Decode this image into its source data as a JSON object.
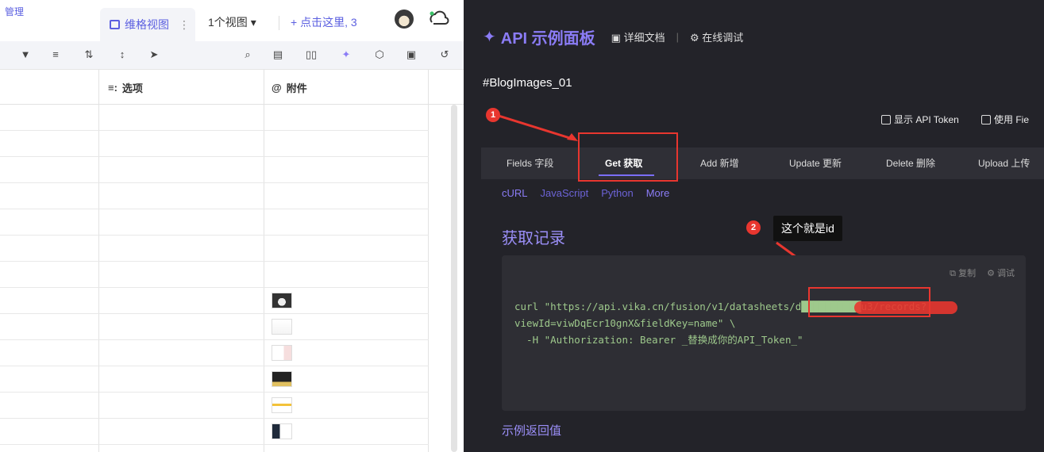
{
  "left_panel": {
    "manage": "管理",
    "view_tab": "维格视图",
    "view_tab_more": "⋮",
    "view_count": "1个视图",
    "add_view": "点击这里, 3",
    "columns": [
      {
        "label": "选项",
        "icon": "≡:"
      },
      {
        "label": "附件",
        "icon": "@"
      }
    ],
    "toolbar_icons": [
      "filter-icon",
      "group-icon",
      "sort-icon",
      "row-height-icon",
      "share-icon",
      "search-icon",
      "form-icon",
      "gallery-icon",
      "api-icon",
      "robot-icon",
      "widget-icon",
      "history-icon"
    ],
    "thumbnail_count": 6
  },
  "right_panel": {
    "title": "API 示例面板",
    "doc_link": "详细文档",
    "debug_link": "在线调试",
    "datasheet_name": "#BlogImages_01",
    "checkbox_token": "显示 API Token",
    "checkbox_field": "使用 Fie",
    "tabs": [
      "Fields 字段",
      "Get 获取",
      "Add 新增",
      "Update 更新",
      "Delete 删除",
      "Upload 上传"
    ],
    "active_tab": "Get 获取",
    "langs": [
      "cURL",
      "JavaScript",
      "Python",
      "More"
    ],
    "section_title": "获取记录",
    "copy": "复制",
    "debug": "调试",
    "code_lines": [
      "curl \"https://api.vika.cn/fusion/v1/datasheets/d██████████u3/records?",
      "viewId=viwDqEcr10gnX&fieldKey=name\" \\",
      "  -H \"Authorization: Bearer _替换成你的API_Token_\""
    ],
    "tooltip": "这个就是id",
    "badge1": "1",
    "badge2": "2",
    "example_return": "示例返回值"
  },
  "colors": {
    "accent": "#8b7cf6",
    "panel": "#232329",
    "red": "#e8362f"
  }
}
